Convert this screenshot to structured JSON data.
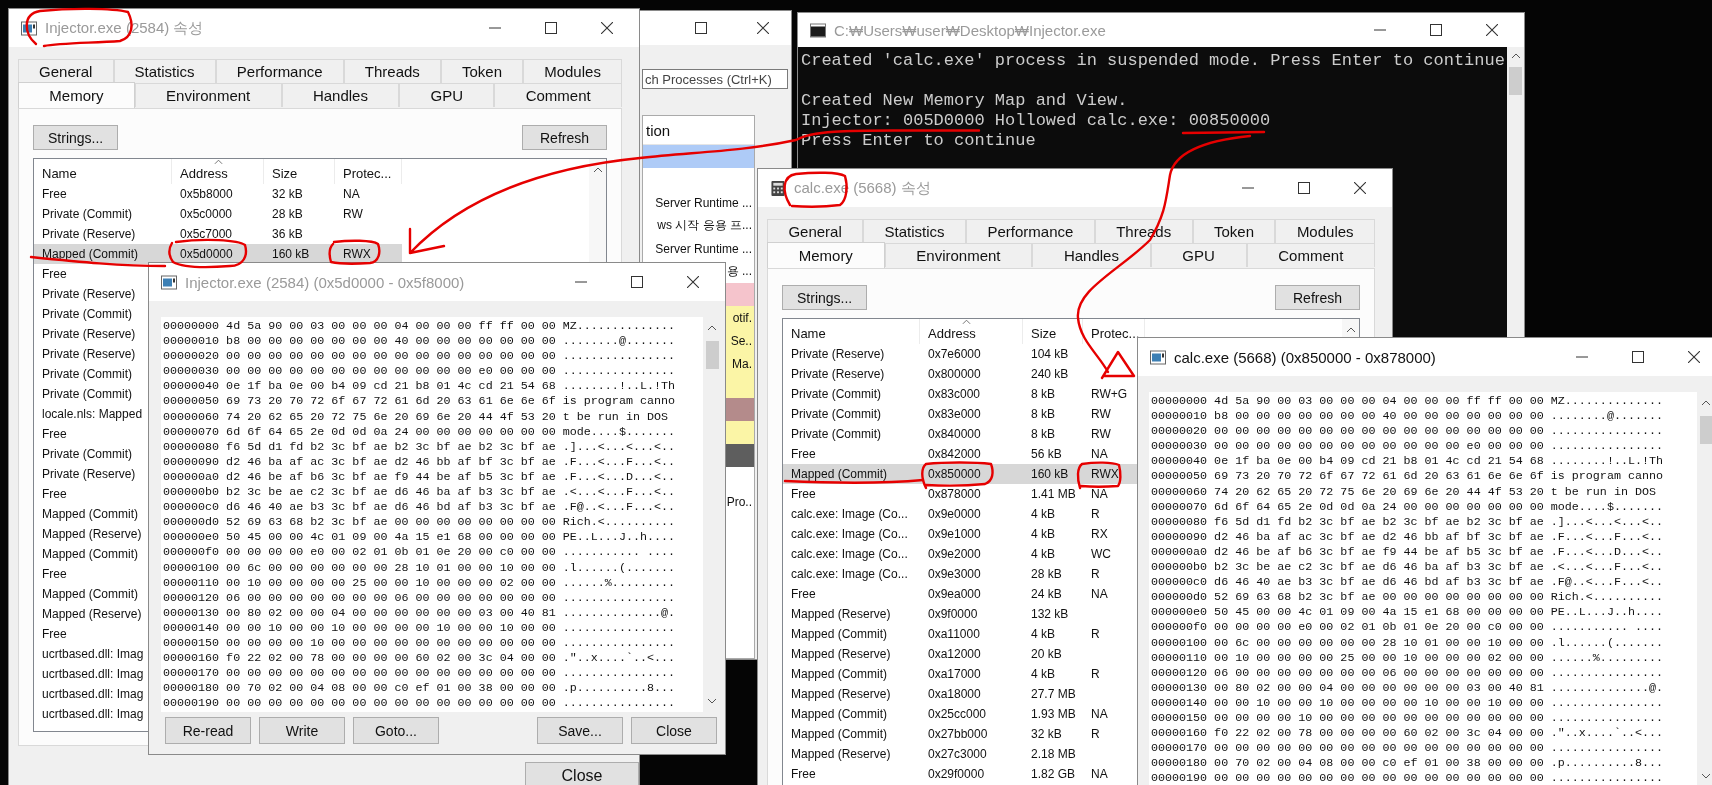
{
  "process_window": {
    "search_placeholder": "ch Processes (Ctrl+K)",
    "column": "tion",
    "rows": [
      {
        "color": "#aecbf7"
      },
      {
        "color": "#ffffff"
      },
      {
        "text": "Server Runtime ...",
        "color": "#ffffff"
      },
      {
        "text": "ws 시작 응용 프...",
        "color": "#ffffff"
      },
      {
        "text": "Server Runtime ...",
        "color": "#ffffff"
      },
      {
        "text": "용 ...",
        "color": "#ffffff"
      },
      {
        "color": "#f5c4cc"
      },
      {
        "text": "otif.",
        "color": "#fbf5a6"
      },
      {
        "text": "Se..",
        "color": "#fbf5a6"
      },
      {
        "text": "Ma.",
        "color": "#fbf5a6"
      },
      {
        "color": "#fbf5a6"
      },
      {
        "color": "#b48b8b"
      },
      {
        "color": "#fbf5a6"
      },
      {
        "color": "#5e5e5e"
      },
      {
        "color": "#ffffff"
      },
      {
        "text": "Pro..",
        "color": "#ffffff"
      }
    ]
  },
  "console": {
    "title": "C:₩Users₩user₩Desktop₩Injector.exe",
    "active": false,
    "blocks": [
      [
        "Created 'calc.exe' process in suspended mode. Press Enter to continue"
      ],
      [
        "Created New Memory Map and View.",
        "Injector: 005D0000 Hollowed calc.exe: 00850000",
        "Press Enter to continue"
      ]
    ]
  },
  "injector_properties": {
    "title": "Injector.exe (2584) 속성",
    "active": false,
    "tabs_row1": [
      {
        "label": "General",
        "selected": false
      },
      {
        "label": "Statistics",
        "selected": false
      },
      {
        "label": "Performance",
        "selected": false
      },
      {
        "label": "Threads",
        "selected": false
      },
      {
        "label": "Token",
        "selected": false
      },
      {
        "label": "Modules",
        "selected": false
      }
    ],
    "tabs_row2": [
      {
        "label": "Memory",
        "selected": true
      },
      {
        "label": "Environment",
        "selected": false
      },
      {
        "label": "Handles",
        "selected": false
      },
      {
        "label": "GPU",
        "selected": false
      },
      {
        "label": "Comment",
        "selected": false
      }
    ],
    "strings_button": "Strings...",
    "refresh_button": "Refresh",
    "columns": [
      {
        "label": "Name",
        "sorted": false
      },
      {
        "label": "Address",
        "sorted": true
      },
      {
        "label": "Size",
        "sorted": false
      },
      {
        "label": "Protec...",
        "sorted": false
      }
    ],
    "rows": [
      {
        "cells": [
          "Free",
          "0x5b8000",
          "32 kB",
          "NA"
        ],
        "selected": false
      },
      {
        "cells": [
          "Private (Commit)",
          "0x5c0000",
          "28 kB",
          "RW"
        ],
        "selected": false
      },
      {
        "cells": [
          "Private (Reserve)",
          "0x5c7000",
          "36 kB"
        ],
        "selected": false
      },
      {
        "cells": [
          "Mapped (Commit)",
          "0x5d0000",
          "160 kB",
          "RWX"
        ],
        "selected": true
      },
      {
        "cells": [
          "Free"
        ],
        "selected": false
      },
      {
        "cells": [
          "Private (Reserve)"
        ],
        "selected": false
      },
      {
        "cells": [
          "Private (Commit)"
        ],
        "selected": false
      },
      {
        "cells": [
          "Private (Reserve)"
        ],
        "selected": false
      },
      {
        "cells": [
          "Private (Reserve)"
        ],
        "selected": false
      },
      {
        "cells": [
          "Private (Commit)"
        ],
        "selected": false
      },
      {
        "cells": [
          "Private (Commit)"
        ],
        "selected": false
      },
      {
        "cells": [
          "locale.nls: Mapped"
        ],
        "selected": false
      },
      {
        "cells": [
          "Free"
        ],
        "selected": false
      },
      {
        "cells": [
          "Private (Commit)"
        ],
        "selected": false
      },
      {
        "cells": [
          "Private (Reserve)"
        ],
        "selected": false
      },
      {
        "cells": [
          "Free"
        ],
        "selected": false
      },
      {
        "cells": [
          "Mapped (Commit)"
        ],
        "selected": false
      },
      {
        "cells": [
          "Mapped (Reserve)"
        ],
        "selected": false
      },
      {
        "cells": [
          "Mapped (Commit)"
        ],
        "selected": false
      },
      {
        "cells": [
          "Free"
        ],
        "selected": false
      },
      {
        "cells": [
          "Mapped (Commit)"
        ],
        "selected": false
      },
      {
        "cells": [
          "Mapped (Reserve)"
        ],
        "selected": false
      },
      {
        "cells": [
          "Free"
        ],
        "selected": false
      },
      {
        "cells": [
          "ucrtbased.dll: Imag"
        ],
        "selected": false
      },
      {
        "cells": [
          "ucrtbased.dll: Imag"
        ],
        "selected": false
      },
      {
        "cells": [
          "ucrtbased.dll: Imag"
        ],
        "selected": false
      },
      {
        "cells": [
          "ucrtbased.dll: Imag"
        ],
        "selected": false
      }
    ],
    "close_button": "Close"
  },
  "injector_hex": {
    "title": "Injector.exe (2584) (0x5d0000 - 0x5f8000)",
    "active": false,
    "rows": [
      "00000000 4d 5a 90 00 03 00 00 00 04 00 00 00 ff ff 00 00 MZ..............",
      "00000010 b8 00 00 00 00 00 00 00 40 00 00 00 00 00 00 00 ........@.......",
      "00000020 00 00 00 00 00 00 00 00 00 00 00 00 00 00 00 00 ................",
      "00000030 00 00 00 00 00 00 00 00 00 00 00 00 e0 00 00 00 ................",
      "00000040 0e 1f ba 0e 00 b4 09 cd 21 b8 01 4c cd 21 54 68 ........!..L.!Th",
      "00000050 69 73 20 70 72 6f 67 72 61 6d 20 63 61 6e 6e 6f is program canno",
      "00000060 74 20 62 65 20 72 75 6e 20 69 6e 20 44 4f 53 20 t be run in DOS ",
      "00000070 6d 6f 64 65 2e 0d 0d 0a 24 00 00 00 00 00 00 00 mode....$.......",
      "00000080 f6 5d d1 fd b2 3c bf ae b2 3c bf ae b2 3c bf ae .]...<...<...<..",
      "00000090 d2 46 ba af ac 3c bf ae d2 46 bb af bf 3c bf ae .F...<...F...<..",
      "000000a0 d2 46 be af b6 3c bf ae f9 44 be af b5 3c bf ae .F...<...D...<..",
      "000000b0 b2 3c be ae c2 3c bf ae d6 46 ba af b3 3c bf ae .<...<...F...<..",
      "000000c0 d6 46 40 ae b3 3c bf ae d6 46 bd af b3 3c bf ae .F@..<...F...<..",
      "000000d0 52 69 63 68 b2 3c bf ae 00 00 00 00 00 00 00 00 Rich.<..........",
      "000000e0 50 45 00 00 4c 01 09 00 4a 15 e1 68 00 00 00 00 PE..L...J..h....",
      "000000f0 00 00 00 00 e0 00 02 01 0b 01 0e 20 00 c0 00 00 ........... ....",
      "00000100 00 6c 00 00 00 00 00 00 28 10 01 00 00 10 00 00 .l......(.......",
      "00000110 00 10 00 00 00 00 25 00 00 10 00 00 00 02 00 00 ......%.........",
      "00000120 06 00 00 00 00 00 00 00 06 00 00 00 00 00 00 00 ................",
      "00000130 00 80 02 00 00 04 00 00 00 00 00 00 03 00 40 81 ..............@.",
      "00000140 00 00 10 00 00 10 00 00 00 00 10 00 00 10 00 00 ................",
      "00000150 00 00 00 00 10 00 00 00 00 00 00 00 00 00 00 00 ................",
      "00000160 f0 22 02 00 78 00 00 00 00 60 02 00 3c 04 00 00 .\"..x....`..<...",
      "00000170 00 00 00 00 00 00 00 00 00 00 00 00 00 00 00 00 ................",
      "00000180 00 70 02 00 04 08 00 00 c0 ef 01 00 38 00 00 00 .p..........8...",
      "00000190 00 00 00 00 00 00 00 00 00 00 00 00 00 00 00 00 ................"
    ],
    "buttons_left": [
      "Re-read",
      "Write",
      "Goto..."
    ],
    "buttons_right": [
      "Save...",
      "Close"
    ]
  },
  "calc_properties": {
    "title": "calc.exe (5668) 속성",
    "active": false,
    "tabs_row1": [
      {
        "label": "General",
        "selected": false
      },
      {
        "label": "Statistics",
        "selected": false
      },
      {
        "label": "Performance",
        "selected": false
      },
      {
        "label": "Threads",
        "selected": false
      },
      {
        "label": "Token",
        "selected": false
      },
      {
        "label": "Modules",
        "selected": false
      }
    ],
    "tabs_row2": [
      {
        "label": "Memory",
        "selected": true
      },
      {
        "label": "Environment",
        "selected": false
      },
      {
        "label": "Handles",
        "selected": false
      },
      {
        "label": "GPU",
        "selected": false
      },
      {
        "label": "Comment",
        "selected": false
      }
    ],
    "strings_button": "Strings...",
    "refresh_button": "Refresh",
    "columns": [
      {
        "label": "Name",
        "sorted": false
      },
      {
        "label": "Address",
        "sorted": true
      },
      {
        "label": "Size",
        "sorted": false
      },
      {
        "label": "Protec...",
        "sorted": false
      }
    ],
    "rows": [
      {
        "cells": [
          "Private (Reserve)",
          "0x7e6000",
          "104 kB"
        ],
        "selected": false
      },
      {
        "cells": [
          "Private (Reserve)",
          "0x800000",
          "240 kB"
        ],
        "selected": false
      },
      {
        "cells": [
          "Private (Commit)",
          "0x83c000",
          "8 kB",
          "RW+G"
        ],
        "selected": false
      },
      {
        "cells": [
          "Private (Commit)",
          "0x83e000",
          "8 kB",
          "RW"
        ],
        "selected": false
      },
      {
        "cells": [
          "Private (Commit)",
          "0x840000",
          "8 kB",
          "RW"
        ],
        "selected": false
      },
      {
        "cells": [
          "Free",
          "0x842000",
          "56 kB",
          "NA"
        ],
        "selected": false
      },
      {
        "cells": [
          "Mapped (Commit)",
          "0x850000",
          "160 kB",
          "RWX"
        ],
        "selected": true
      },
      {
        "cells": [
          "Free",
          "0x878000",
          "1.41 MB",
          "NA"
        ],
        "selected": false
      },
      {
        "cells": [
          "calc.exe: Image (Co...",
          "0x9e0000",
          "4 kB",
          "R"
        ],
        "selected": false
      },
      {
        "cells": [
          "calc.exe: Image (Co...",
          "0x9e1000",
          "4 kB",
          "RX"
        ],
        "selected": false
      },
      {
        "cells": [
          "calc.exe: Image (Co...",
          "0x9e2000",
          "4 kB",
          "WC"
        ],
        "selected": false
      },
      {
        "cells": [
          "calc.exe: Image (Co...",
          "0x9e3000",
          "28 kB",
          "R"
        ],
        "selected": false
      },
      {
        "cells": [
          "Free",
          "0x9ea000",
          "24 kB",
          "NA"
        ],
        "selected": false
      },
      {
        "cells": [
          "Mapped (Reserve)",
          "0x9f0000",
          "132 kB"
        ],
        "selected": false
      },
      {
        "cells": [
          "Mapped (Commit)",
          "0xa11000",
          "4 kB",
          "R"
        ],
        "selected": false
      },
      {
        "cells": [
          "Mapped (Reserve)",
          "0xa12000",
          "20 kB"
        ],
        "selected": false
      },
      {
        "cells": [
          "Mapped (Commit)",
          "0xa17000",
          "4 kB",
          "R"
        ],
        "selected": false
      },
      {
        "cells": [
          "Mapped (Reserve)",
          "0xa18000",
          "27.7 MB"
        ],
        "selected": false
      },
      {
        "cells": [
          "Mapped (Commit)",
          "0x25cc000",
          "1.93 MB",
          "NA"
        ],
        "selected": false
      },
      {
        "cells": [
          "Mapped (Commit)",
          "0x27bb000",
          "32 kB",
          "R"
        ],
        "selected": false
      },
      {
        "cells": [
          "Mapped (Reserve)",
          "0x27c3000",
          "2.18 MB"
        ],
        "selected": false
      },
      {
        "cells": [
          "Free",
          "0x29f0000",
          "1.82 GB",
          "NA"
        ],
        "selected": false
      }
    ]
  },
  "calc_hex": {
    "title": "calc.exe (5668) (0x850000 - 0x878000)",
    "active": true,
    "rows": [
      "00000000 4d 5a 90 00 03 00 00 00 04 00 00 00 ff ff 00 00 MZ..............",
      "00000010 b8 00 00 00 00 00 00 00 40 00 00 00 00 00 00 00 ........@.......",
      "00000020 00 00 00 00 00 00 00 00 00 00 00 00 00 00 00 00 ................",
      "00000030 00 00 00 00 00 00 00 00 00 00 00 00 e0 00 00 00 ................",
      "00000040 0e 1f ba 0e 00 b4 09 cd 21 b8 01 4c cd 21 54 68 ........!..L.!Th",
      "00000050 69 73 20 70 72 6f 67 72 61 6d 20 63 61 6e 6e 6f is program canno",
      "00000060 74 20 62 65 20 72 75 6e 20 69 6e 20 44 4f 53 20 t be run in DOS ",
      "00000070 6d 6f 64 65 2e 0d 0d 0a 24 00 00 00 00 00 00 00 mode....$.......",
      "00000080 f6 5d d1 fd b2 3c bf ae b2 3c bf ae b2 3c bf ae .]...<...<...<..",
      "00000090 d2 46 ba af ac 3c bf ae d2 46 bb af bf 3c bf ae .F...<...F...<..",
      "000000a0 d2 46 be af b6 3c bf ae f9 44 be af b5 3c bf ae .F...<...D...<..",
      "000000b0 b2 3c be ae c2 3c bf ae d6 46 ba af b3 3c bf ae .<...<...F...<..",
      "000000c0 d6 46 40 ae b3 3c bf ae d6 46 bd af b3 3c bf ae .F@..<...F...<..",
      "000000d0 52 69 63 68 b2 3c bf ae 00 00 00 00 00 00 00 00 Rich.<..........",
      "000000e0 50 45 00 00 4c 01 09 00 4a 15 e1 68 00 00 00 00 PE..L...J..h....",
      "000000f0 00 00 00 00 e0 00 02 01 0b 01 0e 20 00 c0 00 00 ........... ....",
      "00000100 00 6c 00 00 00 00 00 00 28 10 01 00 00 10 00 00 .l......(.......",
      "00000110 00 10 00 00 00 00 25 00 00 10 00 00 00 02 00 00 ......%.........",
      "00000120 06 00 00 00 00 00 00 00 06 00 00 00 00 00 00 00 ................",
      "00000130 00 80 02 00 00 04 00 00 00 00 00 00 03 00 40 81 ..............@.",
      "00000140 00 00 10 00 00 10 00 00 00 00 10 00 00 10 00 00 ................",
      "00000150 00 00 00 00 10 00 00 00 00 00 00 00 00 00 00 00 ................",
      "00000160 f0 22 02 00 78 00 00 00 00 60 02 00 3c 04 00 00 .\"..x....`..<...",
      "00000170 00 00 00 00 00 00 00 00 00 00 00 00 00 00 00 00 ................",
      "00000180 00 70 02 00 04 08 00 00 c0 ef 01 00 38 00 00 00 .p..........8...",
      "00000190 00 00 00 00 00 00 00 00 00 00 00 00 00 00 00 00 ................"
    ]
  }
}
